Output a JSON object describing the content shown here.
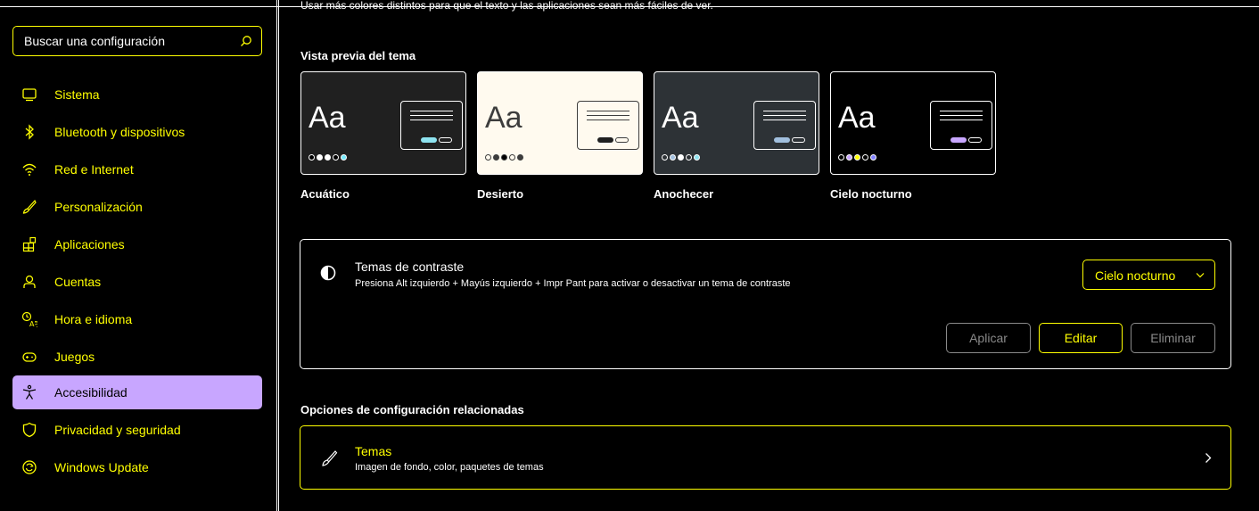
{
  "colors": {
    "accent": "#ffff00",
    "selected_bg": "#c8a6ff",
    "disabled": "#8a8a8a",
    "background": "#000000",
    "text": "#ffffff"
  },
  "search": {
    "placeholder": "Buscar una configuración",
    "icon": "search-icon"
  },
  "sidebar": {
    "items": [
      {
        "label": "Sistema",
        "icon": "monitor-icon"
      },
      {
        "label": "Bluetooth y dispositivos",
        "icon": "bluetooth-icon"
      },
      {
        "label": "Red e Internet",
        "icon": "wifi-icon"
      },
      {
        "label": "Personalización",
        "icon": "brush-icon"
      },
      {
        "label": "Aplicaciones",
        "icon": "apps-icon"
      },
      {
        "label": "Cuentas",
        "icon": "person-icon"
      },
      {
        "label": "Hora e idioma",
        "icon": "time-language-icon"
      },
      {
        "label": "Juegos",
        "icon": "gamepad-icon"
      },
      {
        "label": "Accesibilidad",
        "icon": "accessibility-icon",
        "selected": true
      },
      {
        "label": "Privacidad y seguridad",
        "icon": "shield-icon"
      },
      {
        "label": "Windows Update",
        "icon": "update-icon"
      }
    ]
  },
  "main": {
    "cut_text": "Usar más colores distintos para que el texto y las aplicaciones sean más fáciles de ver.",
    "preview_title": "Vista previa del tema",
    "themes": [
      {
        "name": "Acuático",
        "sample": "Aa",
        "bg": "#202020",
        "fg": "#ffffff",
        "dots": [
          "#000000",
          "#ffffff",
          "#ffffff",
          "#000000",
          "#75e9fc"
        ],
        "btn1": "#8ee3f0",
        "btn2": "#202020"
      },
      {
        "name": "Desierto",
        "sample": "Aa",
        "bg": "#fffaef",
        "fg": "#3d3d3d",
        "dots": [
          "#fffaef",
          "#3d3d3d",
          "#000000",
          "#fffaef",
          "#3d3d3d"
        ],
        "btn1": "#202020",
        "btn2": "#fffaef"
      },
      {
        "name": "Anochecer",
        "sample": "Aa",
        "bg": "#2d3236",
        "fg": "#ffffff",
        "dots": [
          "#2d3236",
          "#a1bfde",
          "#ffffff",
          "#2d3236",
          "#8ee3f0"
        ],
        "btn1": "#a1bfde",
        "btn2": "#2d3236"
      },
      {
        "name": "Cielo nocturno",
        "sample": "Aa",
        "bg": "#000000",
        "fg": "#ffffff",
        "dots": [
          "#000000",
          "#c8a6ff",
          "#ffff00",
          "#000000",
          "#8080ff"
        ],
        "btn1": "#c8a6ff",
        "btn2": "#000000"
      }
    ],
    "contrast": {
      "title": "Temas de contraste",
      "description": "Presiona Alt izquierdo + Mayús izquierdo + Impr Pant para activar o desactivar un tema de contraste",
      "selected": "Cielo nocturno",
      "buttons": {
        "apply": "Aplicar",
        "edit": "Editar",
        "delete": "Eliminar"
      }
    },
    "related_title": "Opciones de configuración relacionadas",
    "related": [
      {
        "title": "Temas",
        "description": "Imagen de fondo, color, paquetes de temas",
        "icon": "brush-icon"
      }
    ]
  }
}
